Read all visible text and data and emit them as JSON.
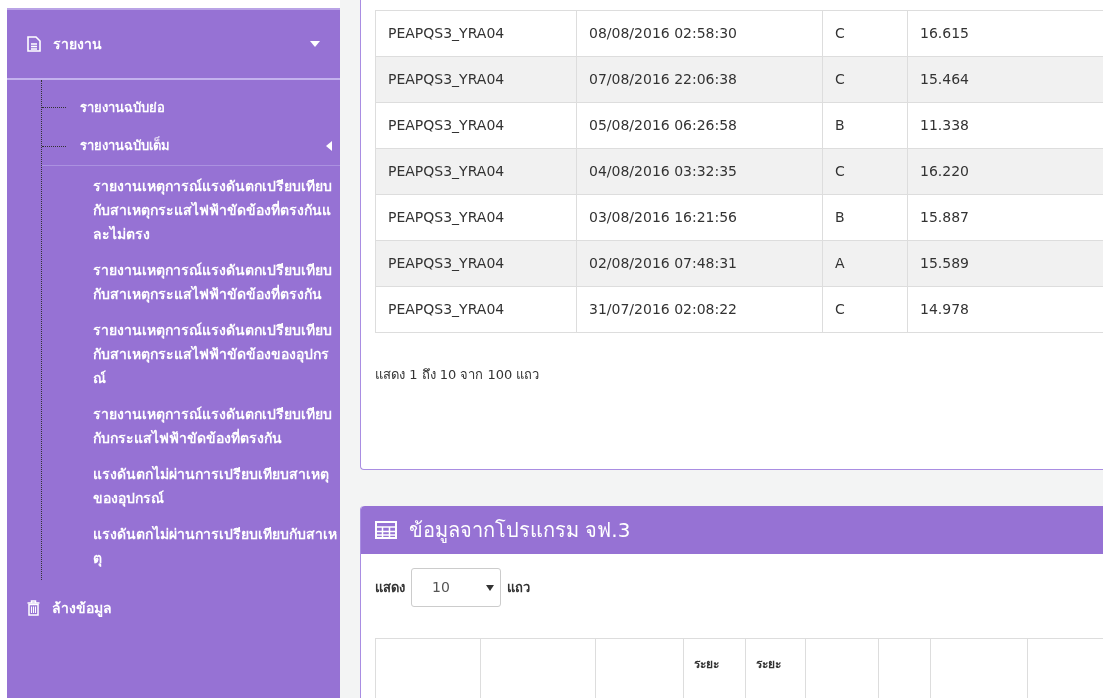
{
  "sidebar": {
    "items": [
      {
        "label": "รายงาน",
        "kind": "file",
        "expanded": true,
        "children": [
          {
            "label": "รายงานฉบับย่อ"
          },
          {
            "label": "รายงานฉบับเต็ม",
            "children": [
              {
                "label": "รายงานเหตุการณ์แรงดันตกเปรียบเทียบกับสาเหตุกระแสไฟฟ้าขัดข้องที่ตรงกันและไม่ตรง"
              },
              {
                "label": "รายงานเหตุการณ์แรงดันตกเปรียบเทียบกับสาเหตุกระแสไฟฟ้าขัดข้องที่ตรงกัน"
              },
              {
                "label": "รายงานเหตุการณ์แรงดันตกเปรียบเทียบกับสาเหตุกระแสไฟฟ้าขัดข้องของอุปกรณ์"
              },
              {
                "label": "รายงานเหตุการณ์แรงดันตกเปรียบเทียบกับกระแสไฟฟ้าขัดข้องที่ตรงกัน"
              },
              {
                "label": "แรงดันตกไม่ผ่านการเปรียบเทียบสาเหตุของอุปกรณ์"
              },
              {
                "label": "แรงดันตกไม่ผ่านการเปรียบเทียบกับสาเหตุ"
              }
            ]
          }
        ]
      },
      {
        "label": "ล้างข้อมูล",
        "kind": "trash"
      }
    ]
  },
  "events_table": {
    "rows": [
      [
        "PEAPQS3_YRA04",
        "08/08/2016 02:58:30",
        "C",
        "16.615"
      ],
      [
        "PEAPQS3_YRA04",
        "07/08/2016 22:06:38",
        "C",
        "15.464"
      ],
      [
        "PEAPQS3_YRA04",
        "05/08/2016 06:26:58",
        "B",
        "11.338"
      ],
      [
        "PEAPQS3_YRA04",
        "04/08/2016 03:32:35",
        "C",
        "16.220"
      ],
      [
        "PEAPQS3_YRA04",
        "03/08/2016 16:21:56",
        "B",
        "15.887"
      ],
      [
        "PEAPQS3_YRA04",
        "02/08/2016 07:48:31",
        "A",
        "15.589"
      ],
      [
        "PEAPQS3_YRA04",
        "31/07/2016 02:08:22",
        "C",
        "14.978"
      ]
    ],
    "info": "แสดง 1 ถึง 10 จาก 100 แถว"
  },
  "program_panel": {
    "title": "ข้อมูลจากโปรแกรม จฟ.3",
    "length_prefix": "แสดง",
    "length_value": "10",
    "length_suffix": "แถว",
    "column_4_heading": "ระยะ",
    "column_5_heading": "ระยะ"
  }
}
